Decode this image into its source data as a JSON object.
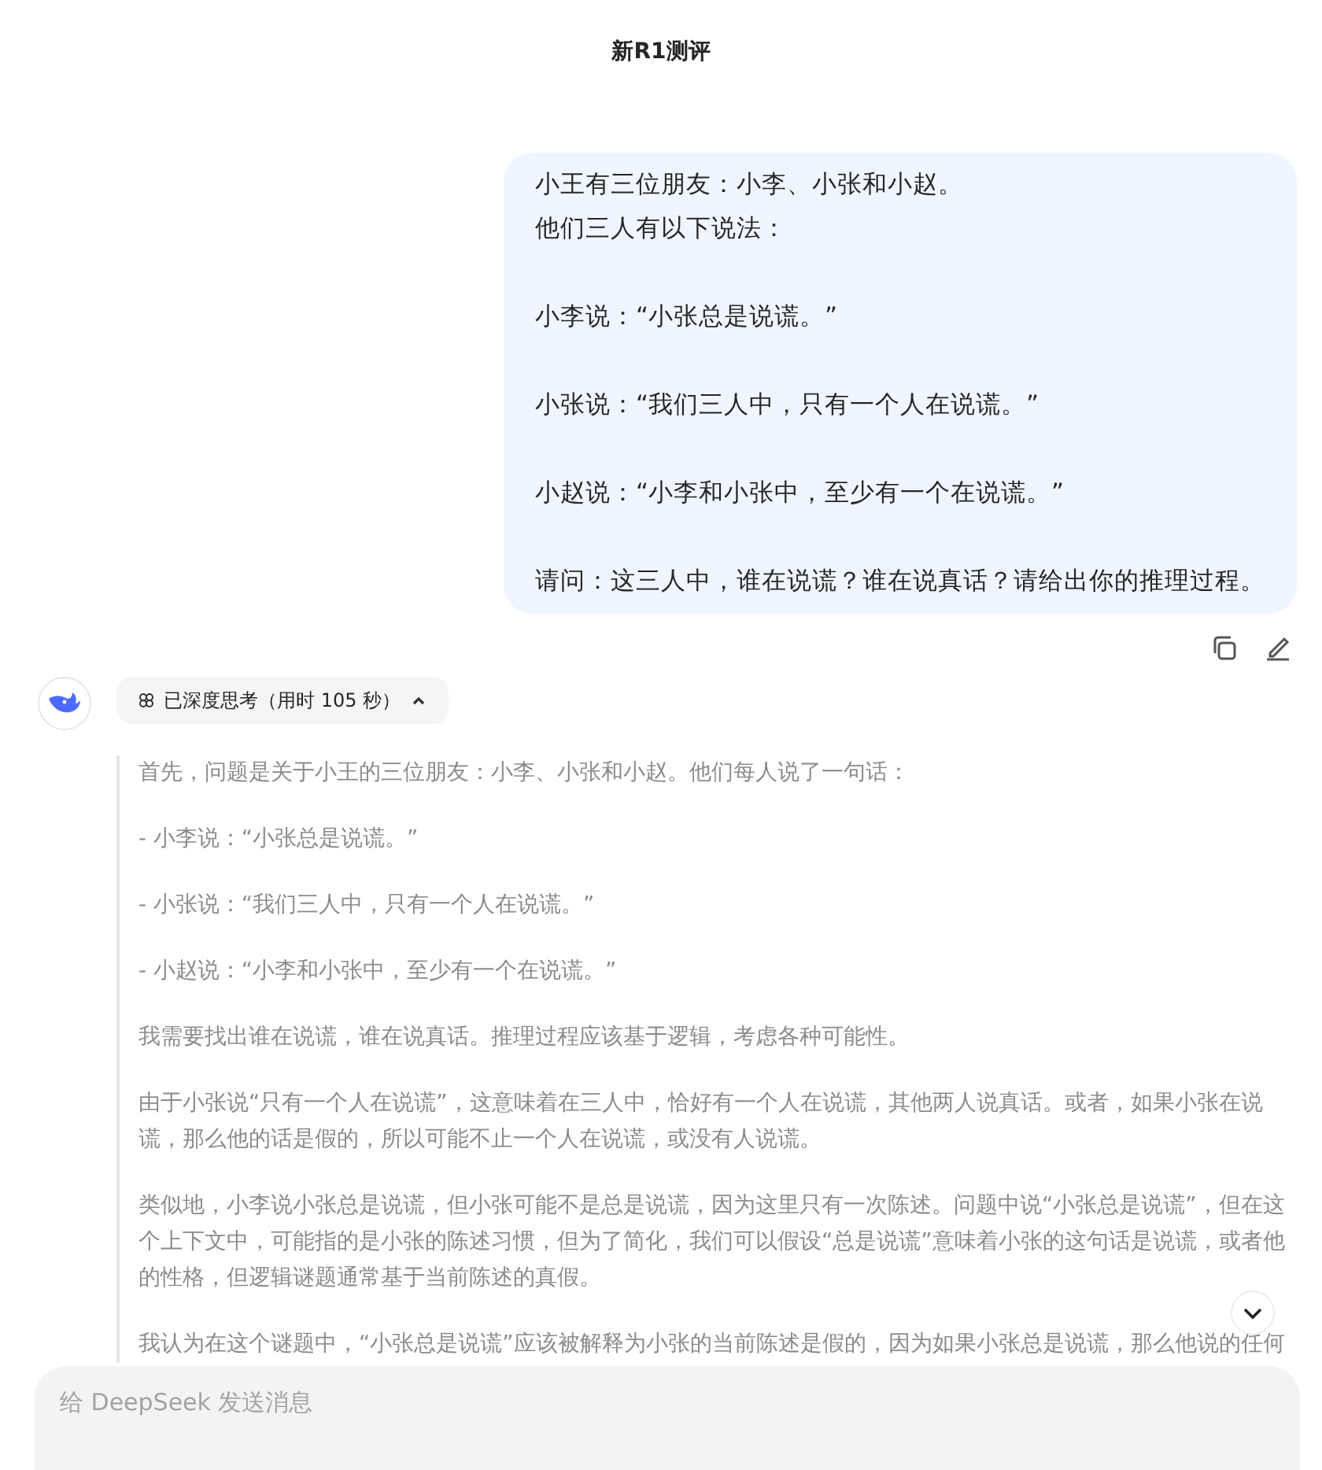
{
  "header": {
    "title": "新R1测评"
  },
  "user_message": {
    "paragraphs": [
      [
        "小王有三位朋友：小李、小张和小赵。",
        "他们三人有以下说法："
      ],
      [
        "小李说：“小张总是说谎。”"
      ],
      [
        "小张说：“我们三人中，只有一个人在说谎。”"
      ],
      [
        "小赵说：“小李和小张中，至少有一个在说谎。”"
      ],
      [
        "请问：这三人中，谁在说谎？谁在说真话？请给出你的推理过程。"
      ]
    ]
  },
  "thinking": {
    "label": "已深度思考（用时 105 秒）",
    "expanded": true,
    "paragraphs": [
      "首先，问题是关于小王的三位朋友：小李、小张和小赵。他们每人说了一句话：",
      "- 小李说：“小张总是说谎。”",
      "- 小张说：“我们三人中，只有一个人在说谎。”",
      "- 小赵说：“小李和小张中，至少有一个在说谎。”",
      "我需要找出谁在说谎，谁在说真话。推理过程应该基于逻辑，考虑各种可能性。",
      "由于小张说“只有一个人在说谎”，这意味着在三人中，恰好有一个人在说谎，其他两人说真话。或者，如果小张在说谎，那么他的话是假的，所以可能不止一个人在说谎，或没有人说谎。",
      "类似地，小李说小张总是说谎，但小张可能不是总是说谎，因为这里只有一次陈述。问题中说“小张总是说谎”，但在这个上下文中，可能指的是小张的陈述习惯，但为了简化，我们可以假设“总是说谎”意味着小张的这句话是说谎，或者他的性格，但逻辑谜题通常基于当前陈述的真假。",
      "我认为在这个谜题中，“小张总是说谎”应该被解释为小张的当前陈述是假的，因为如果小张总是说谎，那么他说的任何"
    ]
  },
  "input": {
    "placeholder": "给 DeepSeek 发送消息"
  }
}
